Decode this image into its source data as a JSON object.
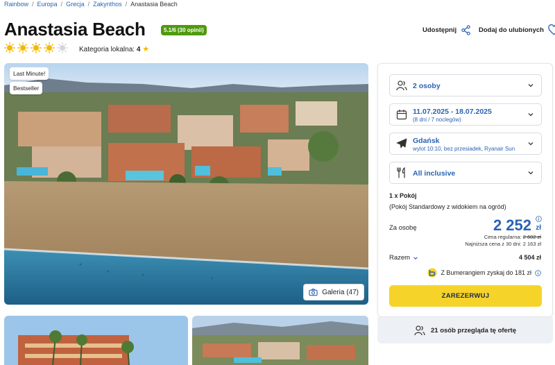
{
  "breadcrumb": [
    "Rainbow",
    "Europa",
    "Grecja",
    "Zakynthos",
    "Anastasia Beach"
  ],
  "hotel": {
    "name": "Anastasia Beach",
    "rating": "5.1/6 (30 opinii)",
    "suns_filled": 4,
    "suns_total": 5,
    "category_label": "Kategoria lokalna:",
    "category_value": "4"
  },
  "actions": {
    "share": "Udostępnij",
    "favorite": "Dodaj do ulubionych"
  },
  "gallery": {
    "tags": [
      "Last Minute!",
      "Bestseller"
    ],
    "button": "Galeria (47)"
  },
  "booking": {
    "guests": "2 osoby",
    "dates": "11.07.2025 - 18.07.2025",
    "dates_sub": "(8 dni / 7 noclegów)",
    "departure": "Gdańsk",
    "departure_sub": "wylot 10:10, bez przesiadek, Ryanair Sun",
    "board": "All inclusive",
    "rooms": "1 x Pokój",
    "room_type": "(Pokój Standardowy z widokiem na ogród)",
    "per_person_label": "Za osobę",
    "price": "2 252",
    "currency": "zł",
    "regular_label": "Cena regularna:",
    "regular_price": "2 602 zł",
    "lowest_label": "Najniższa cena z 30 dni:",
    "lowest_price": "2 163 zł",
    "total_label": "Razem",
    "total_value": "4 504 zł",
    "bumerang": "Z Bumerangiem zyskaj do 181 zł",
    "reserve": "ZAREZERWUJ"
  },
  "viewers": "21 osób przegląda tę ofertę",
  "colors": {
    "accent_blue": "#2a63b3",
    "reserve_yellow": "#f6d329",
    "rating_green": "#4f9a0e",
    "sun": "#f2b900"
  }
}
